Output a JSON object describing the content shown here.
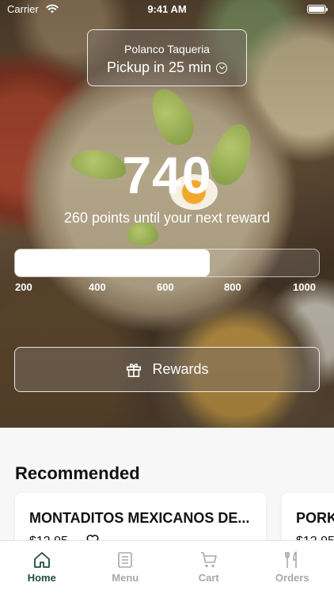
{
  "status_bar": {
    "carrier": "Carrier",
    "time": "9:41 AM"
  },
  "location": {
    "name": "Polanco Taqueria",
    "pickup": "Pickup in 25 min"
  },
  "points": {
    "value": "740",
    "caption": "260 points until your next reward"
  },
  "progress": {
    "fraction": 0.64,
    "ticks": [
      "200",
      "400",
      "600",
      "800",
      "1000"
    ]
  },
  "rewards_button": {
    "label": "Rewards"
  },
  "recommended": {
    "title": "Recommended",
    "cards": [
      {
        "title": "MONTADITOS MEXICANOS DE...",
        "price": "$12.95"
      },
      {
        "title": "PORK",
        "price": "$12.95"
      }
    ]
  },
  "tabs": [
    {
      "label": "Home",
      "icon": "home-icon",
      "active": true
    },
    {
      "label": "Menu",
      "icon": "menu-icon",
      "active": false
    },
    {
      "label": "Cart",
      "icon": "cart-icon",
      "active": false
    },
    {
      "label": "Orders",
      "icon": "orders-icon",
      "active": false
    }
  ],
  "colors": {
    "accent": "#1f4d3a",
    "inactive": "#a8a8a8",
    "background": "#f7f7f7"
  }
}
